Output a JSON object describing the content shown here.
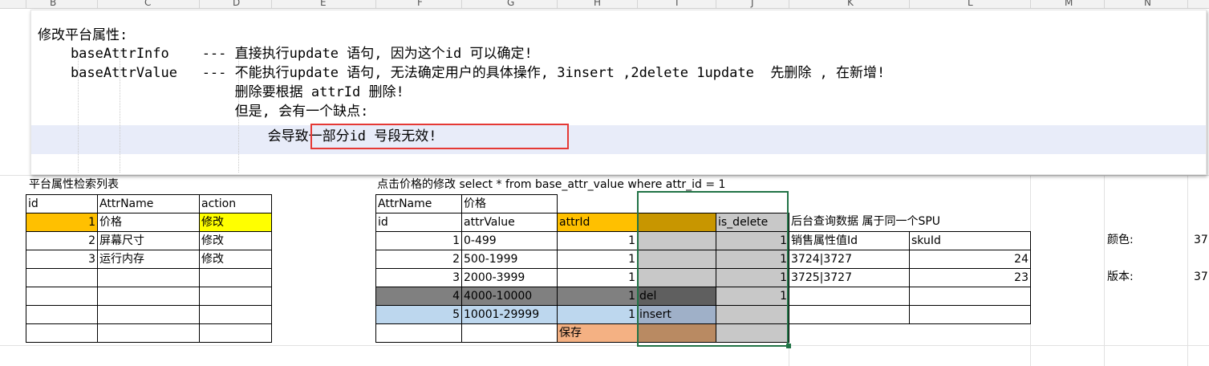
{
  "note": {
    "line1": "修改平台属性:",
    "line2": "    baseAttrInfo    --- 直接执行update 语句, 因为这个id 可以确定!",
    "line3": "    baseAttrValue   --- 不能执行update 语句, 无法确定用户的具体操作, 3insert ,2delete 1update  先删除 , 在新增!",
    "line4": "                        删除要根据 attrId 删除!",
    "line5": "                        但是, 会有一个缺点:",
    "line6": "                            会导致一部分id 号段无效!"
  },
  "left_table": {
    "title": "平台属性检索列表",
    "headers": [
      "id",
      "AttrName",
      "action"
    ],
    "rows": [
      {
        "id": "1",
        "name": "价格",
        "action": "修改"
      },
      {
        "id": "2",
        "name": "屏幕尺寸",
        "action": "修改"
      },
      {
        "id": "3",
        "name": "运行内存",
        "action": "修改"
      }
    ]
  },
  "mid_table": {
    "title": "点击价格的修改  select * from base_attr_value where attr_id = 1",
    "attrname_label": "AttrName",
    "attrname_value": "价格",
    "headers": [
      "id",
      "attrValue",
      "attrId",
      "",
      "is_delete"
    ],
    "rows": [
      {
        "id": "1",
        "value": "0-499",
        "attrId": "1",
        "flag": "",
        "is_delete": "1"
      },
      {
        "id": "2",
        "value": "500-1999",
        "attrId": "1",
        "flag": "",
        "is_delete": "1"
      },
      {
        "id": "3",
        "value": "2000-3999",
        "attrId": "1",
        "flag": "",
        "is_delete": "1"
      },
      {
        "id": "4",
        "value": "4000-10000",
        "attrId": "1",
        "flag": "del",
        "is_delete": "1"
      },
      {
        "id": "5",
        "value": "10001-29999",
        "attrId": "1",
        "flag": "insert",
        "is_delete": ""
      }
    ],
    "save_label": "保存"
  },
  "right_table": {
    "title": "后台查询数据  属于同一个SPU",
    "headers": [
      "销售属性值Id",
      "skuId"
    ],
    "rows": [
      {
        "ids": "3724|3727",
        "sku": "24"
      },
      {
        "ids": "3725|3727",
        "sku": "23"
      }
    ]
  },
  "far_right": {
    "color_label": "颜色:",
    "color_value": "37",
    "version_label": "版本:",
    "version_value": "37"
  },
  "column_headers": [
    "B",
    "C",
    "D",
    "E",
    "F",
    "G",
    "H",
    "I",
    "J",
    "K",
    "L",
    "M",
    "N"
  ],
  "colors": {
    "orange": "#ffc000",
    "yellow": "#ffff00",
    "dark_gold": "#c89600",
    "gray_sel": "#c8c8c8",
    "dark_gray": "#808080",
    "light_blue": "#bdd7ee",
    "salmon": "#f4b183",
    "green_border": "#217346",
    "red_box": "#e53935"
  }
}
